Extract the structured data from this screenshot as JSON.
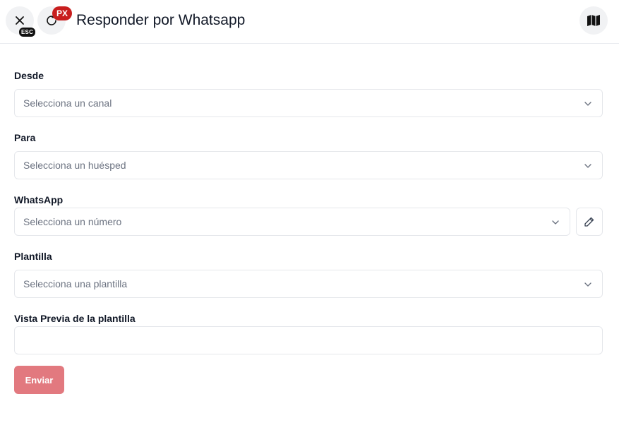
{
  "header": {
    "title": "Responder por Whatsapp",
    "esc_badge": "ESC",
    "px_badge": "PX",
    "badge_color": "#c81e1e",
    "icons": [
      "close-icon",
      "refresh-icon",
      "book-map-icon"
    ]
  },
  "form": {
    "desde": {
      "label": "Desde",
      "placeholder": "Selecciona un canal"
    },
    "para": {
      "label": "Para",
      "placeholder": "Selecciona un huésped"
    },
    "whatsapp": {
      "label": "WhatsApp",
      "placeholder": "Selecciona un número",
      "edit_icon": "pencil-icon"
    },
    "plantilla": {
      "label": "Plantilla",
      "placeholder": "Selecciona una plantilla"
    },
    "preview": {
      "label": "Vista Previa de la plantilla",
      "value": ""
    },
    "submit": {
      "label": "Enviar",
      "color": "#e2797f",
      "disabled": true
    }
  }
}
